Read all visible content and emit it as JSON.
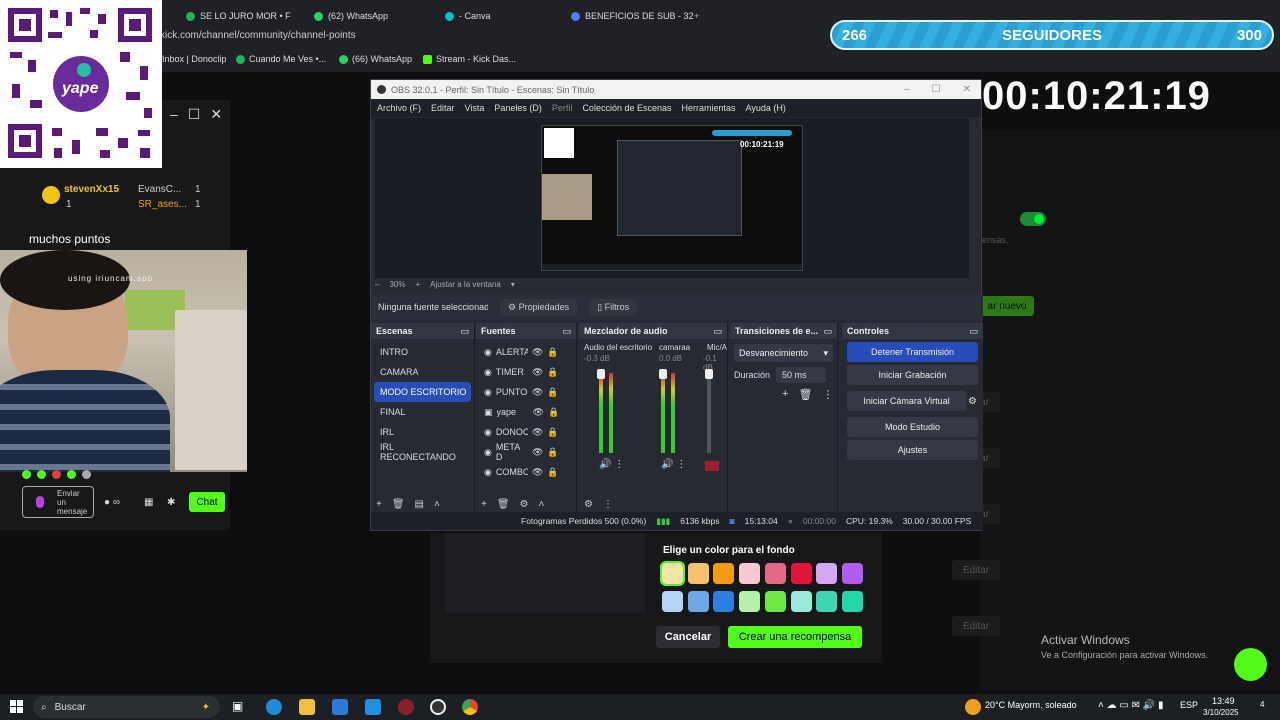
{
  "browser": {
    "tabs": [
      {
        "label": "SE LO JURO MOR • F",
        "color": "#1db954"
      },
      {
        "label": "(62) WhatsApp",
        "color": "#25d366"
      },
      {
        "label": "- Canva",
        "color": "#00c4cc"
      },
      {
        "label": "BENEFICIOS DE SUB - 32",
        "color": "#4a7dff"
      }
    ],
    "url": "kick.com/channel/community/channel-points",
    "bookmarks": [
      "Inbox | Donoclip",
      "Cuando Me Ves •...",
      "(66) WhatsApp",
      "Stream - Kick Das..."
    ]
  },
  "overlay": {
    "followers_count": "266",
    "followers_label": "SEGUIDORES",
    "followers_goal": "300",
    "timer": "00:10:21:19",
    "qr_brand": "yape"
  },
  "chat": {
    "users": [
      {
        "name": "stevenXx15",
        "value": "1"
      },
      {
        "name": "EvansC...",
        "value": "1"
      },
      {
        "name": "SR_ases...",
        "value": "1"
      },
      {
        "name": "",
        "value": "1"
      }
    ],
    "message": "muchos puntos",
    "webcam_watermark": "using iriuncam.app",
    "send_placeholder": "Enviar un mensaje",
    "chat_button": "Chat"
  },
  "obs": {
    "title": "OBS 32.0.1 - Perfil: Sin Título - Escenas: Sin Título",
    "menu": [
      "Archivo (F)",
      "Editar",
      "Vista",
      "Paneles (D)",
      "Perfil",
      "Colección de Escenas",
      "Herramientas",
      "Ayuda (H)"
    ],
    "preview_timer": "00:10:21:19",
    "zoom_label": "30%",
    "fit_label": "Ajustar a la ventana",
    "no_source": "Ninguna fuente seleccionada",
    "properties": "Propiedades",
    "filters": "Filtros",
    "scenes_title": "Escenas",
    "scenes": [
      "INTRO",
      "CAMARA",
      "MODO ESCRITORIO",
      "FINAL",
      "IRL",
      "IRL RECONECTANDO"
    ],
    "sources_title": "Fuentes",
    "sources": [
      "ALERTA",
      "TIMER",
      "PUNTOS",
      "yape",
      "DONOC",
      "META D",
      "COMBO"
    ],
    "mixer_title": "Mezclador de audio",
    "mixer_channels": [
      {
        "name": "Audio del escritorio",
        "db": "-0.3 dB"
      },
      {
        "name": "camaraa",
        "db": "0.0 dB"
      },
      {
        "name": "Mic/A",
        "db": "-0.1 dB"
      }
    ],
    "transitions_title": "Transiciones de e...",
    "transition_type": "Desvanecimiento",
    "duration_label": "Duración",
    "duration_value": "50 ms",
    "controls_title": "Controles",
    "controls": [
      "Detener Transmisión",
      "Iniciar Grabación",
      "Iniciar Cámara Virtual",
      "Modo Estudio",
      "Ajustes"
    ],
    "status": {
      "dropped": "Fotogramas Perdidos 500 (0.0%)",
      "bitrate": "6136 kbps",
      "live_time": "15:13:04",
      "rec_time": "00:00:00",
      "cpu": "CPU: 19.3%",
      "fps": "30.00 / 30.00 FPS"
    }
  },
  "background_page": {
    "text_fragment": "ensas.",
    "create_new": "ar nuevo",
    "edit_label": "Editar"
  },
  "modal": {
    "color_title": "Elige un color para el fondo",
    "colors_row1": [
      "#f5e6a8",
      "#f6c26b",
      "#f39c12",
      "#f8c8d4",
      "#e26a86",
      "#e0153a",
      "#d4a8f0",
      "#b35cf0"
    ],
    "colors_row2": [
      "#b4d4f5",
      "#6fa8e6",
      "#2e7de0",
      "#b7f0a8",
      "#6ee846",
      "#9be8dc",
      "#3fd6b4",
      "#20d9a8"
    ],
    "cancel": "Cancelar",
    "create": "Crear una recompensa"
  },
  "windows": {
    "activate_title": "Activar Windows",
    "activate_sub": "Ve a Configuración para activar Windows."
  },
  "taskbar": {
    "search": "Buscar",
    "weather": "20°C  Mayorm. soleado",
    "lang": "ESP",
    "time": "13:49",
    "date": "3/10/2025",
    "notif": "4"
  }
}
